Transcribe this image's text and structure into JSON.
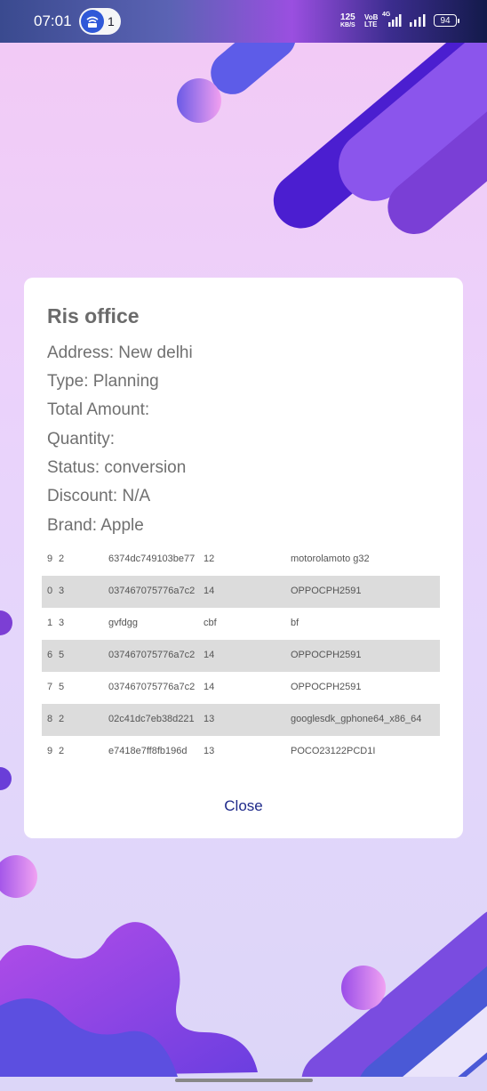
{
  "status_bar": {
    "time": "07:01",
    "hotspot_count": "1",
    "net_speed_value": "125",
    "net_speed_unit": "KB/S",
    "volte_top": "VoB",
    "volte_bottom": "LTE",
    "network_type": "4G",
    "battery": "94"
  },
  "dialog": {
    "title": "Ris office",
    "lines": [
      {
        "label": "Address: ",
        "value": "New delhi"
      },
      {
        "label": "Type: ",
        "value": "Planning"
      },
      {
        "label": "Total Amount: ",
        "value": ""
      },
      {
        "label": "Quantity: ",
        "value": ""
      },
      {
        "label": "Status: ",
        "value": "conversion"
      },
      {
        "label": "Discount: ",
        "value": "N/A"
      },
      {
        "label": "Brand: ",
        "value": "Apple"
      }
    ],
    "rows": [
      {
        "a": "9",
        "b": "2",
        "c": "6374dc749103be77",
        "d": "12",
        "e": "motorolamoto g32"
      },
      {
        "a": "0",
        "b": "3",
        "c": "037467075776a7c2",
        "d": "14",
        "e": "OPPOCPH2591"
      },
      {
        "a": "1",
        "b": "3",
        "c": "gvfdgg",
        "d": "cbf",
        "e": "bf"
      },
      {
        "a": "6",
        "b": "5",
        "c": "037467075776a7c2",
        "d": "14",
        "e": "OPPOCPH2591"
      },
      {
        "a": "7",
        "b": "5",
        "c": "037467075776a7c2",
        "d": "14",
        "e": "OPPOCPH2591"
      },
      {
        "a": "8",
        "b": "2",
        "c": "02c41dc7eb38d221",
        "d": "13",
        "e": "googlesdk_gphone64_x86_64"
      },
      {
        "a": "9",
        "b": "2",
        "c": "e7418e7ff8fb196d",
        "d": "13",
        "e": "POCO23122PCD1I"
      }
    ],
    "close_label": "Close"
  },
  "colors": {
    "accent": "#1f2a8a",
    "row_shade": "#dcdcdc",
    "decor_purple": "#8b4fe6",
    "decor_indigo": "#4b1ed0"
  }
}
